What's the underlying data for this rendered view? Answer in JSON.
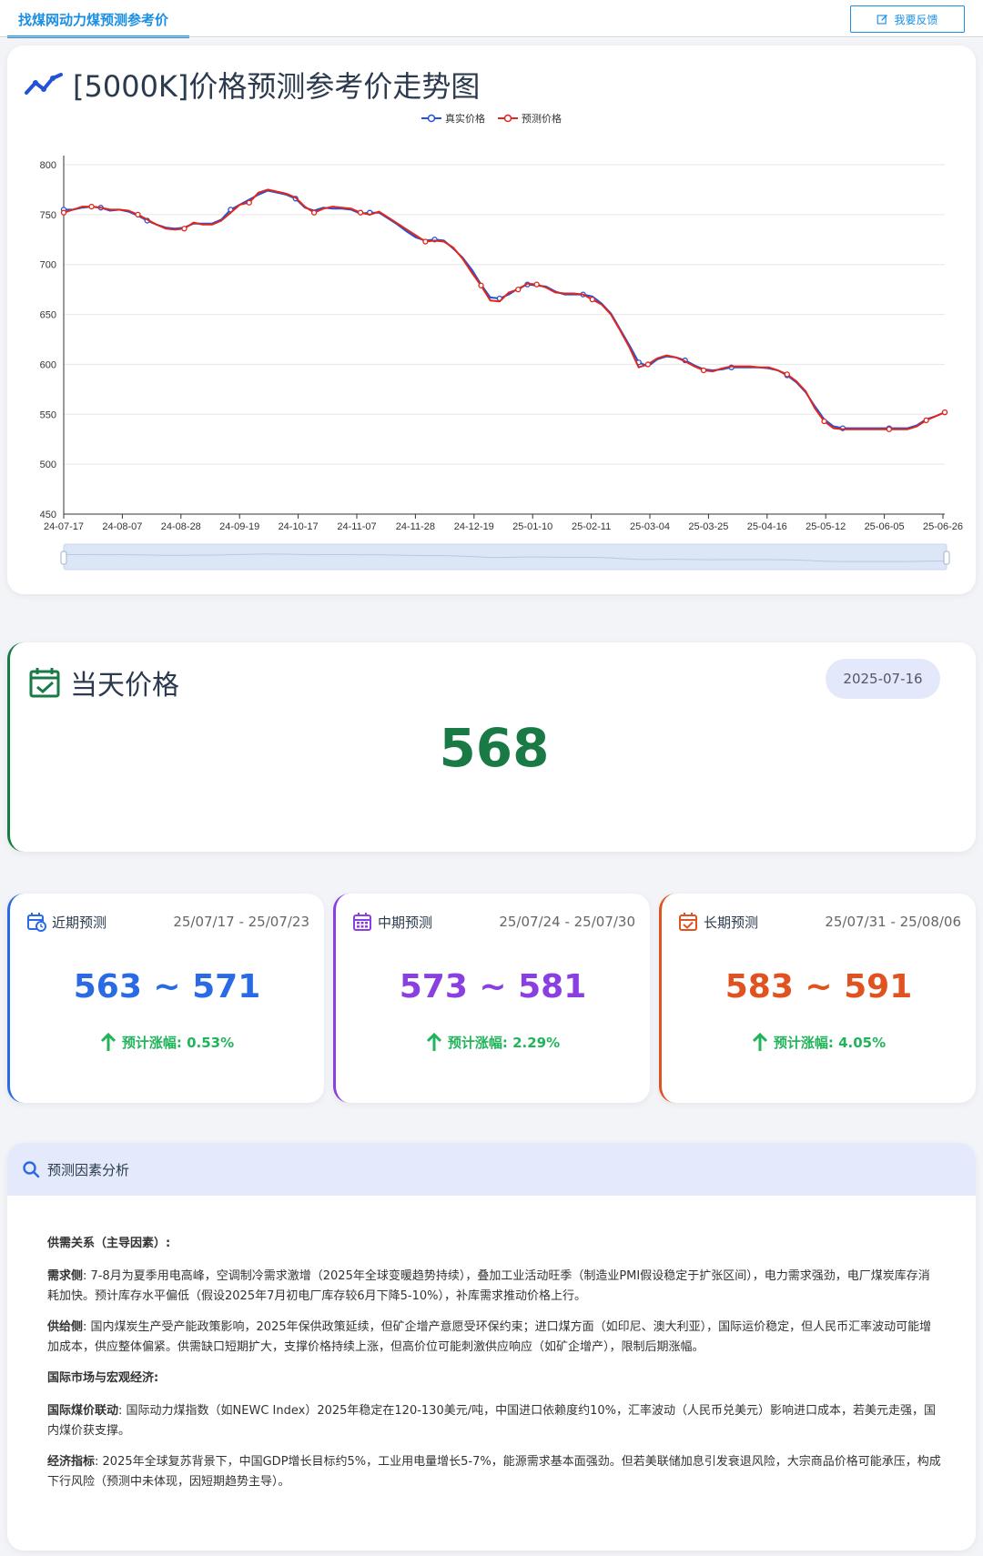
{
  "topbar": {
    "tab_label": "找煤网动力煤预测参考价",
    "feedback_label": "我要反馈"
  },
  "chart_card": {
    "title": "[5000K]价格预测参考价走势图"
  },
  "chart_data": {
    "type": "line",
    "title": "[5000K]价格预测参考价走势图",
    "xlabel": "",
    "ylabel": "",
    "ylim": [
      450,
      800
    ],
    "yticks": [
      450,
      500,
      550,
      600,
      650,
      700,
      750,
      800
    ],
    "xticks": [
      "24-07-17",
      "24-08-07",
      "24-08-28",
      "24-09-19",
      "24-10-17",
      "24-11-07",
      "24-11-28",
      "24-12-19",
      "25-01-10",
      "25-02-11",
      "25-03-04",
      "25-03-25",
      "25-04-16",
      "25-05-12",
      "25-06-05",
      "25-06-26"
    ],
    "grid": "horizontal",
    "legend": "top",
    "series": [
      {
        "name": "真实价格",
        "color": "#2352d9",
        "values": [
          755,
          755,
          757,
          758,
          757,
          754,
          755,
          753,
          749,
          744,
          740,
          737,
          736,
          737,
          741,
          741,
          741,
          745,
          755,
          760,
          765,
          770,
          774,
          772,
          770,
          766,
          757,
          754,
          757,
          756,
          756,
          755,
          751,
          752,
          752,
          746,
          740,
          733,
          727,
          724,
          725,
          724,
          716,
          707,
          695,
          680,
          667,
          666,
          670,
          676,
          680,
          679,
          678,
          673,
          670,
          670,
          670,
          668,
          661,
          651,
          635,
          619,
          602,
          598,
          605,
          608,
          607,
          604,
          599,
          595,
          594,
          595,
          597,
          597,
          597,
          597,
          596,
          594,
          589,
          582,
          572,
          558,
          545,
          538,
          536,
          536,
          536,
          536,
          536,
          536,
          536,
          536,
          539,
          545,
          548,
          552
        ]
      },
      {
        "name": "预测价格",
        "color": "#e1261c",
        "values": [
          752,
          755,
          758,
          758,
          757,
          755,
          755,
          754,
          750,
          745,
          740,
          736,
          735,
          736,
          742,
          740,
          740,
          744,
          752,
          760,
          762,
          772,
          775,
          773,
          771,
          767,
          758,
          752,
          756,
          758,
          757,
          756,
          752,
          750,
          753,
          747,
          741,
          735,
          729,
          723,
          724,
          723,
          717,
          706,
          692,
          679,
          664,
          663,
          672,
          675,
          681,
          680,
          677,
          672,
          671,
          671,
          670,
          665,
          660,
          650,
          634,
          617,
          597,
          600,
          606,
          609,
          607,
          603,
          598,
          594,
          593,
          596,
          598,
          598,
          598,
          597,
          597,
          594,
          590,
          583,
          573,
          556,
          543,
          536,
          535,
          535,
          535,
          535,
          535,
          535,
          535,
          535,
          538,
          544,
          548,
          552
        ]
      }
    ],
    "markers": {
      "真实价格": [
        0,
        4,
        9,
        18,
        25,
        33,
        40,
        47,
        50,
        56,
        62,
        67,
        72,
        78,
        84,
        89,
        95
      ],
      "预测价格": [
        0,
        3,
        8,
        13,
        20,
        27,
        32,
        39,
        45,
        49,
        51,
        57,
        63,
        69,
        78,
        82,
        89,
        93,
        95
      ]
    }
  },
  "today": {
    "title": "当天价格",
    "date": "2025-07-16",
    "price": "568"
  },
  "forecasts": {
    "short": {
      "title": "近期预测",
      "range": "25/07/17 - 25/07/23",
      "value": "563 ~ 571",
      "rise": "预计涨幅: 0.53%",
      "color": "#2a6ae5"
    },
    "mid": {
      "title": "中期预测",
      "range": "25/07/24 - 25/07/30",
      "value": "573 ~ 581",
      "rise": "预计涨幅: 2.29%",
      "color": "#8a3fe0"
    },
    "long": {
      "title": "长期预测",
      "range": "25/07/31 - 25/08/06",
      "value": "583 ~ 591",
      "rise": "预计涨幅: 4.05%",
      "color": "#e0521f"
    }
  },
  "analysis": {
    "title": "预测因素分析",
    "section1": "供需关系（主导因素）:",
    "demand_label": "需求侧",
    "demand_text": ": 7-8月为夏季用电高峰，空调制冷需求激增（2025年全球变暖趋势持续），叠加工业活动旺季（制造业PMI假设稳定于扩张区间），电力需求强劲，电厂煤炭库存消耗加快。预计库存水平偏低（假设2025年7月初电厂库存较6月下降5-10%），补库需求推动价格上行。",
    "supply_label": "供给侧",
    "supply_text": ": 国内煤炭生产受产能政策影响，2025年保供政策延续，但矿企增产意愿受环保约束；进口煤方面（如印尼、澳大利亚），国际运价稳定，但人民币汇率波动可能增加成本，供应整体偏紧。供需缺口短期扩大，支撑价格持续上涨，但高价位可能刺激供应响应（如矿企增产），限制后期涨幅。",
    "section2": "国际市场与宏观经济:",
    "intl_label": "国际煤价联动",
    "intl_text": ": 国际动力煤指数（如NEWC Index）2025年稳定在120-130美元/吨，中国进口依赖度约10%，汇率波动（人民币兑美元）影响进口成本，若美元走强，国内煤价获支撑。",
    "econ_label": "经济指标",
    "econ_text": ": 2025年全球复苏背景下，中国GDP增长目标约5%，工业用电量增长5-7%，能源需求基本面强劲。但若美联储加息引发衰退风险，大宗商品价格可能承压，构成下行风险（预测中未体现，因短期趋势主导）。"
  }
}
